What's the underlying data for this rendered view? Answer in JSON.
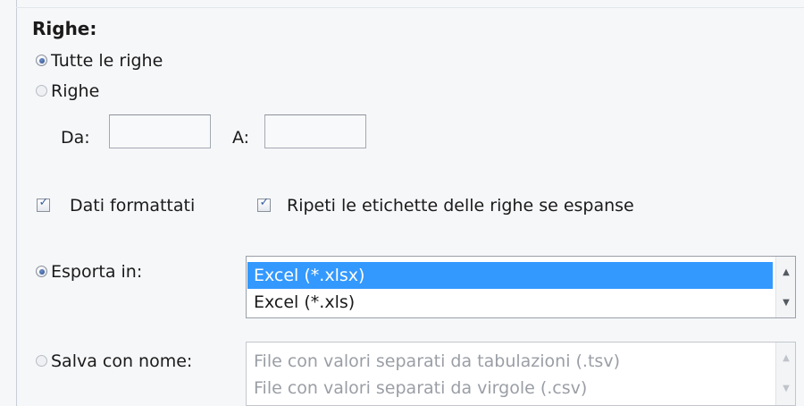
{
  "rows_section": {
    "title": "Righe:",
    "all_rows_label": "Tutte le righe",
    "rows_label": "Righe",
    "from_label": "Da:",
    "to_label": "A:",
    "from_value": "",
    "to_value": ""
  },
  "options": {
    "formatted_data_label": "Dati formattati",
    "repeat_labels_label": "Ripeti le etichette delle righe se espanse"
  },
  "export": {
    "label": "Esporta in:",
    "items": [
      "Excel (*.xlsx)",
      "Excel (*.xls)"
    ],
    "selected": "Excel (*.xlsx)"
  },
  "save_as": {
    "label": "Salva con nome:",
    "items": [
      "File con valori separati da tabulazioni (.tsv)",
      "File con valori separati da virgole (.csv)"
    ]
  },
  "icons": {
    "scroll_up": "▲",
    "scroll_down": "▼",
    "check": "✓"
  },
  "colors": {
    "selection": "#3399ff",
    "radio_dot": "#2b4f8f"
  }
}
